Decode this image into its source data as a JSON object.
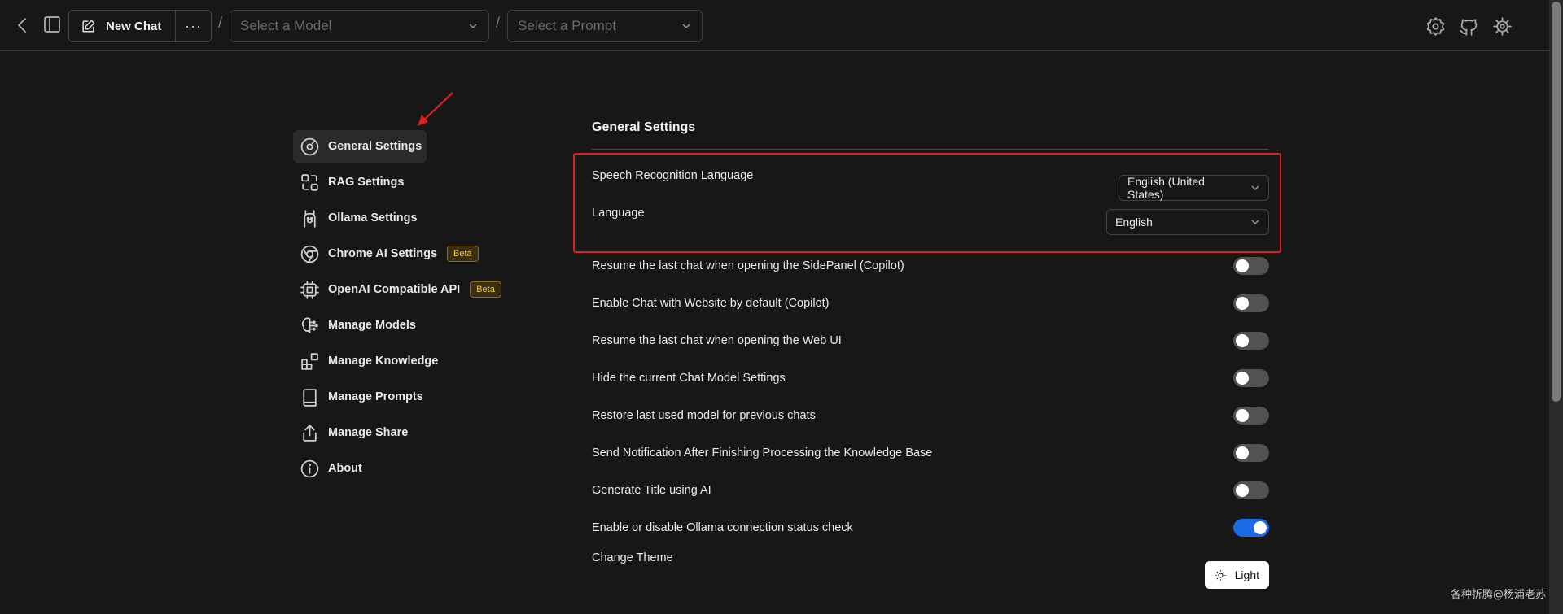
{
  "header": {
    "new_chat_label": "New Chat",
    "more_label": "···",
    "separator": "/",
    "model_select_placeholder": "Select a Model",
    "prompt_select_placeholder": "Select a Prompt"
  },
  "sidebar": {
    "items": [
      {
        "label": "General Settings",
        "icon": "general-settings-icon",
        "active": true
      },
      {
        "label": "RAG Settings",
        "icon": "rag-icon"
      },
      {
        "label": "Ollama Settings",
        "icon": "llama-icon"
      },
      {
        "label": "Chrome AI Settings",
        "icon": "chrome-icon",
        "badge": "Beta"
      },
      {
        "label": "OpenAI Compatible API",
        "icon": "chip-icon",
        "badge": "Beta"
      },
      {
        "label": "Manage Models",
        "icon": "brain-icon"
      },
      {
        "label": "Manage Knowledge",
        "icon": "blocks-icon"
      },
      {
        "label": "Manage Prompts",
        "icon": "book-icon"
      },
      {
        "label": "Manage Share",
        "icon": "share-icon"
      },
      {
        "label": "About",
        "icon": "info-icon"
      }
    ]
  },
  "main": {
    "title": "General Settings",
    "speech_label": "Speech Recognition Language",
    "speech_value": "English (United States)",
    "language_label": "Language",
    "language_value": "English",
    "toggles": [
      {
        "label": "Resume the last chat when opening the SidePanel (Copilot)",
        "on": false
      },
      {
        "label": "Enable Chat with Website by default (Copilot)",
        "on": false
      },
      {
        "label": "Resume the last chat when opening the Web UI",
        "on": false
      },
      {
        "label": "Hide the current Chat Model Settings",
        "on": false
      },
      {
        "label": "Restore last used model for previous chats",
        "on": false
      },
      {
        "label": "Send Notification After Finishing Processing the Knowledge Base",
        "on": false
      },
      {
        "label": "Generate Title using AI",
        "on": false
      },
      {
        "label": "Enable or disable Ollama connection status check",
        "on": true
      }
    ],
    "theme_label": "Change Theme",
    "theme_button": "Light"
  },
  "watermark": "各种折腾@杨浦老苏",
  "colors": {
    "accent": "#1d6ae5",
    "highlight_box": "#e02020",
    "badge": "#f2c94c"
  }
}
